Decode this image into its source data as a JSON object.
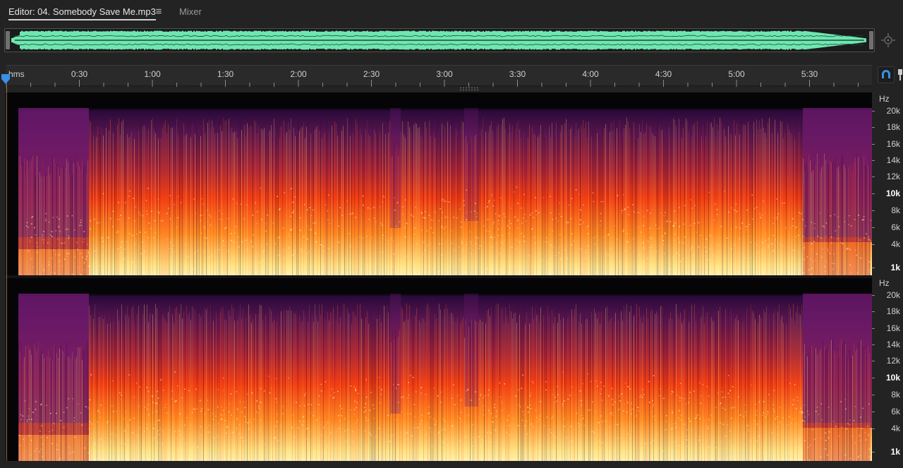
{
  "tabs": {
    "editor_label": "Editor: 04. Somebody Save Me.mp3",
    "menu_glyph": "≡",
    "mixer_label": "Mixer"
  },
  "overview": {
    "waveform_color": "#6ee6b0",
    "handle_color": "#707070"
  },
  "timeline": {
    "format_label": "hms",
    "ticks": [
      "0:30",
      "1:00",
      "1:30",
      "2:00",
      "2:30",
      "3:00",
      "3:30",
      "4:00",
      "4:30",
      "5:00",
      "5:30"
    ],
    "playhead_color": "#3b8fe6"
  },
  "icons": {
    "zoom_nav": "zoom-navigator-icon",
    "snap": "magnet-snap-icon",
    "pin": "pin-icon"
  },
  "frequency_scale": {
    "unit": "Hz",
    "labels": [
      {
        "text": "20k",
        "bold": false
      },
      {
        "text": "18k",
        "bold": false
      },
      {
        "text": "16k",
        "bold": false
      },
      {
        "text": "14k",
        "bold": false
      },
      {
        "text": "12k",
        "bold": false
      },
      {
        "text": "10k",
        "bold": true
      },
      {
        "text": "8k",
        "bold": false
      },
      {
        "text": "6k",
        "bold": false
      },
      {
        "text": "4k",
        "bold": false
      },
      {
        "text": "1k",
        "bold": true
      }
    ]
  },
  "spectrogram": {
    "channels": 2,
    "palette": {
      "high": "#ffe78a",
      "mid": "#f03a12",
      "low": "#6b1a6c",
      "silence": "#050508"
    }
  }
}
